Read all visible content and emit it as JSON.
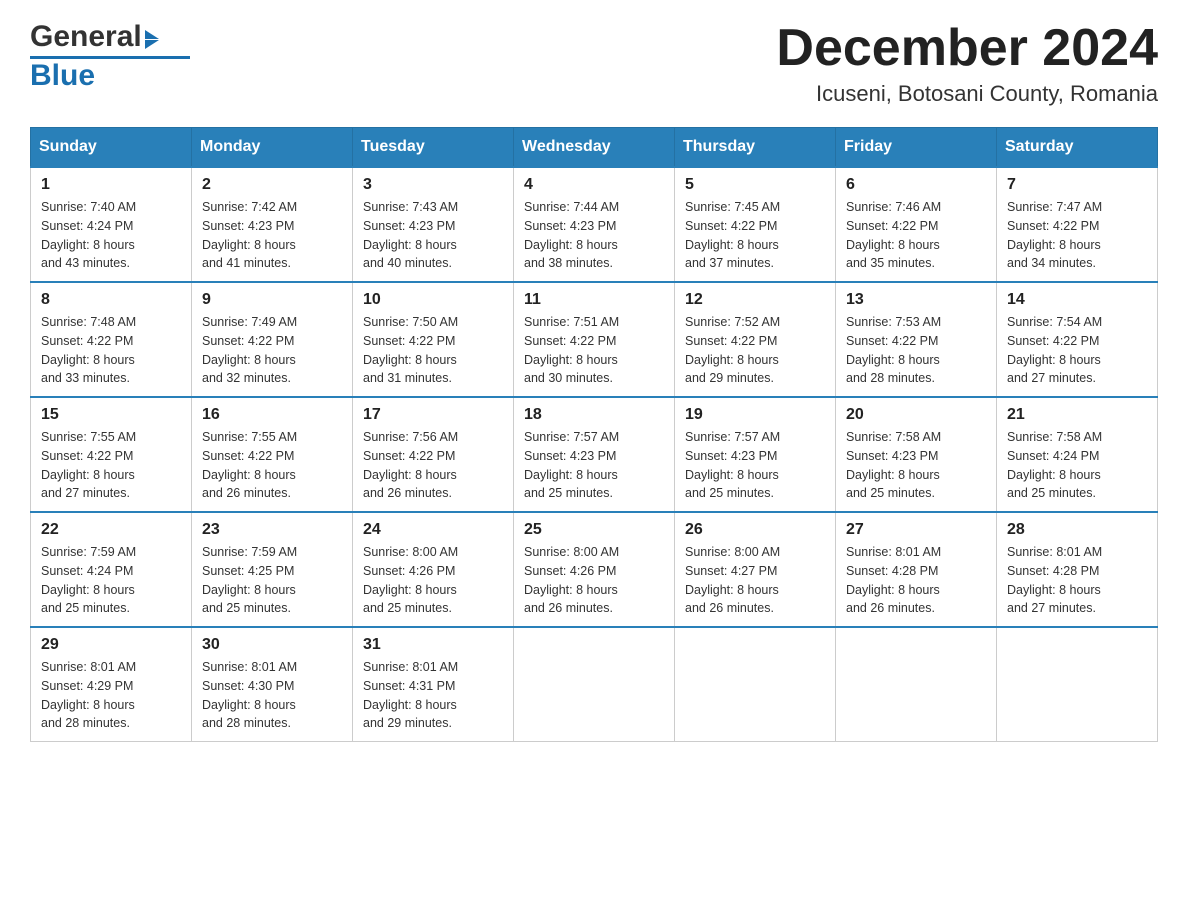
{
  "header": {
    "logo_general": "General",
    "logo_blue": "Blue",
    "month_title": "December 2024",
    "location": "Icuseni, Botosani County, Romania"
  },
  "days_of_week": [
    "Sunday",
    "Monday",
    "Tuesday",
    "Wednesday",
    "Thursday",
    "Friday",
    "Saturday"
  ],
  "weeks": [
    [
      {
        "day": "1",
        "sunrise": "7:40 AM",
        "sunset": "4:24 PM",
        "daylight": "8 hours and 43 minutes."
      },
      {
        "day": "2",
        "sunrise": "7:42 AM",
        "sunset": "4:23 PM",
        "daylight": "8 hours and 41 minutes."
      },
      {
        "day": "3",
        "sunrise": "7:43 AM",
        "sunset": "4:23 PM",
        "daylight": "8 hours and 40 minutes."
      },
      {
        "day": "4",
        "sunrise": "7:44 AM",
        "sunset": "4:23 PM",
        "daylight": "8 hours and 38 minutes."
      },
      {
        "day": "5",
        "sunrise": "7:45 AM",
        "sunset": "4:22 PM",
        "daylight": "8 hours and 37 minutes."
      },
      {
        "day": "6",
        "sunrise": "7:46 AM",
        "sunset": "4:22 PM",
        "daylight": "8 hours and 35 minutes."
      },
      {
        "day": "7",
        "sunrise": "7:47 AM",
        "sunset": "4:22 PM",
        "daylight": "8 hours and 34 minutes."
      }
    ],
    [
      {
        "day": "8",
        "sunrise": "7:48 AM",
        "sunset": "4:22 PM",
        "daylight": "8 hours and 33 minutes."
      },
      {
        "day": "9",
        "sunrise": "7:49 AM",
        "sunset": "4:22 PM",
        "daylight": "8 hours and 32 minutes."
      },
      {
        "day": "10",
        "sunrise": "7:50 AM",
        "sunset": "4:22 PM",
        "daylight": "8 hours and 31 minutes."
      },
      {
        "day": "11",
        "sunrise": "7:51 AM",
        "sunset": "4:22 PM",
        "daylight": "8 hours and 30 minutes."
      },
      {
        "day": "12",
        "sunrise": "7:52 AM",
        "sunset": "4:22 PM",
        "daylight": "8 hours and 29 minutes."
      },
      {
        "day": "13",
        "sunrise": "7:53 AM",
        "sunset": "4:22 PM",
        "daylight": "8 hours and 28 minutes."
      },
      {
        "day": "14",
        "sunrise": "7:54 AM",
        "sunset": "4:22 PM",
        "daylight": "8 hours and 27 minutes."
      }
    ],
    [
      {
        "day": "15",
        "sunrise": "7:55 AM",
        "sunset": "4:22 PM",
        "daylight": "8 hours and 27 minutes."
      },
      {
        "day": "16",
        "sunrise": "7:55 AM",
        "sunset": "4:22 PM",
        "daylight": "8 hours and 26 minutes."
      },
      {
        "day": "17",
        "sunrise": "7:56 AM",
        "sunset": "4:22 PM",
        "daylight": "8 hours and 26 minutes."
      },
      {
        "day": "18",
        "sunrise": "7:57 AM",
        "sunset": "4:23 PM",
        "daylight": "8 hours and 25 minutes."
      },
      {
        "day": "19",
        "sunrise": "7:57 AM",
        "sunset": "4:23 PM",
        "daylight": "8 hours and 25 minutes."
      },
      {
        "day": "20",
        "sunrise": "7:58 AM",
        "sunset": "4:23 PM",
        "daylight": "8 hours and 25 minutes."
      },
      {
        "day": "21",
        "sunrise": "7:58 AM",
        "sunset": "4:24 PM",
        "daylight": "8 hours and 25 minutes."
      }
    ],
    [
      {
        "day": "22",
        "sunrise": "7:59 AM",
        "sunset": "4:24 PM",
        "daylight": "8 hours and 25 minutes."
      },
      {
        "day": "23",
        "sunrise": "7:59 AM",
        "sunset": "4:25 PM",
        "daylight": "8 hours and 25 minutes."
      },
      {
        "day": "24",
        "sunrise": "8:00 AM",
        "sunset": "4:26 PM",
        "daylight": "8 hours and 25 minutes."
      },
      {
        "day": "25",
        "sunrise": "8:00 AM",
        "sunset": "4:26 PM",
        "daylight": "8 hours and 26 minutes."
      },
      {
        "day": "26",
        "sunrise": "8:00 AM",
        "sunset": "4:27 PM",
        "daylight": "8 hours and 26 minutes."
      },
      {
        "day": "27",
        "sunrise": "8:01 AM",
        "sunset": "4:28 PM",
        "daylight": "8 hours and 26 minutes."
      },
      {
        "day": "28",
        "sunrise": "8:01 AM",
        "sunset": "4:28 PM",
        "daylight": "8 hours and 27 minutes."
      }
    ],
    [
      {
        "day": "29",
        "sunrise": "8:01 AM",
        "sunset": "4:29 PM",
        "daylight": "8 hours and 28 minutes."
      },
      {
        "day": "30",
        "sunrise": "8:01 AM",
        "sunset": "4:30 PM",
        "daylight": "8 hours and 28 minutes."
      },
      {
        "day": "31",
        "sunrise": "8:01 AM",
        "sunset": "4:31 PM",
        "daylight": "8 hours and 29 minutes."
      },
      null,
      null,
      null,
      null
    ]
  ],
  "labels": {
    "sunrise": "Sunrise:",
    "sunset": "Sunset:",
    "daylight": "Daylight:"
  }
}
